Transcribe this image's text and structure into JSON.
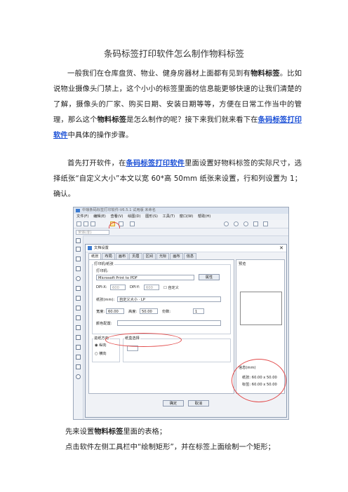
{
  "title": "条码标签打印软件怎么制作物料标签",
  "p1": {
    "a": "一般我们在仓库盘货、物业、健身房器材上面都有见到有",
    "b": "物料标签",
    "c": "。比如说物业摄像头门禁上，这个小小的标签里面的信息能更够快速的让我们清楚的了解，摄像头的厂家、购买日期、安装日期等等，方便在日常工作当中的管理，那么这个",
    "d": "物料标签",
    "e": "是怎么制作的呢？接下来我们就来看下在",
    "link": "条码标签打印软件",
    "f": "中具体的操作步骤。"
  },
  "p2": {
    "a": "首先打开软件，在",
    "link": "条码标签打印软件",
    "b": "里面设置好物料标签的实际尺寸，选择纸张“自定义大小”本文以宽 60*高 50mm 纸张来设置，行和列设置为 1；确认。"
  },
  "p3": {
    "a": "先来设置",
    "b": "物料标签",
    "c": "里面的表格；"
  },
  "p4": "点击软件左侧工具栏中“绘制矩形”，并在标签上面绘制一个矩形；",
  "shot": {
    "window_title": "中琅条码标签打印软件-V6.5.1 试用版 未命名",
    "menu": [
      "文件(F)",
      "编辑(E)",
      "查看(V)",
      "绘图(D)",
      "图形(S)",
      "工具(T)",
      "窗口(W)",
      "帮助(H)"
    ],
    "font_box": "宋体(非)",
    "dialog_title": "文档设置",
    "close": "✕",
    "tabs": [
      "纸张",
      "布局",
      "画布",
      "页眉",
      "区间",
      "光标",
      "画布",
      "信息"
    ],
    "section_printer": "打印机/纸张",
    "printer_label": "打印机:",
    "printer_value": "Microsoft Print to PDF",
    "properties_btn": "属性",
    "dpi_x_label": "DPI-X:",
    "dpi_x_value": "600",
    "dpi_y_label": "DPI-Y:",
    "dpi_y_value": "600",
    "custom_label": "自定义",
    "paper_label": "纸张(mm):",
    "paper_value": "自定义大小 · LP",
    "width_label": "宽度:",
    "width_value": "60.00",
    "height_label": "高度:",
    "height_value": "50.00",
    "count_label": "份数:",
    "count_value": "1",
    "color_label": "颜色配置:",
    "direction_label": "进纸方向",
    "portrait": "纵向",
    "landscape": "横向",
    "paper_select_label": "纸盒选择",
    "preview_label": "预览",
    "info_label": "信息(mm)",
    "info_paper": "纸张: 60.00 x 50.00",
    "info_label_size": "标签: 60.00 x 50.00",
    "ok_btn": "确定",
    "cancel_btn": "取消"
  }
}
